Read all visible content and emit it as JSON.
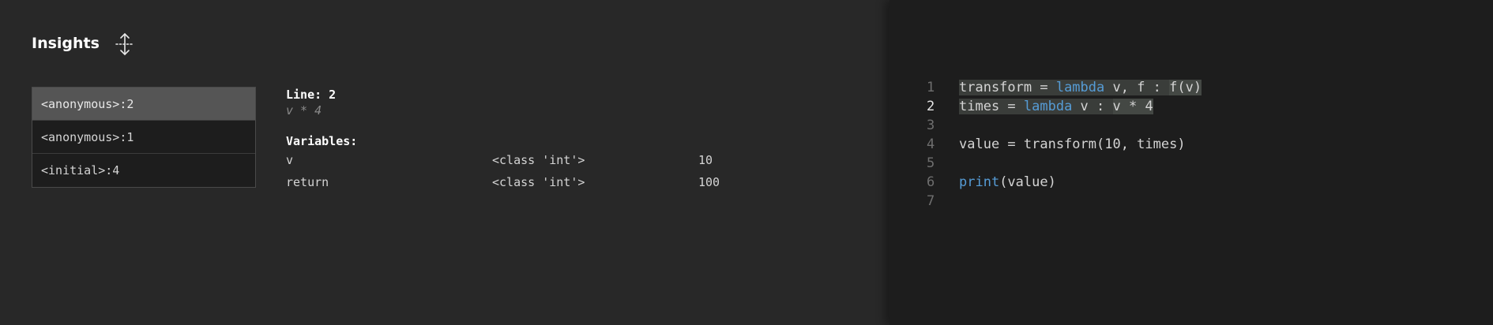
{
  "insights": {
    "title": "Insights",
    "stack": [
      {
        "label": "<anonymous>:2",
        "selected": true
      },
      {
        "label": "<anonymous>:1",
        "selected": false
      },
      {
        "label": "<initial>:4",
        "selected": false
      }
    ],
    "details": {
      "line_label": "Line: 2",
      "expression": "v * 4",
      "variables_label": "Variables:",
      "variables": [
        {
          "name": "v",
          "type": "<class 'int'>",
          "value": "10"
        },
        {
          "name": "return",
          "type": "<class 'int'>",
          "value": "100"
        }
      ]
    }
  },
  "editor": {
    "active_line": 2,
    "lines": [
      {
        "num": "1",
        "tokens": [
          {
            "t": "transform = ",
            "c": "hl"
          },
          {
            "t": "lambda",
            "c": "kw hl"
          },
          {
            "t": " v, f : ",
            "c": "hl"
          },
          {
            "t": "f(v)",
            "c": "hl2"
          }
        ]
      },
      {
        "num": "2",
        "tokens": [
          {
            "t": "times = ",
            "c": "hl"
          },
          {
            "t": "lambda",
            "c": "kw hl"
          },
          {
            "t": " v : ",
            "c": "hl"
          },
          {
            "t": "v * 4",
            "c": "hl2"
          }
        ]
      },
      {
        "num": "3",
        "tokens": []
      },
      {
        "num": "4",
        "tokens": [
          {
            "t": "value = transform(10, times)",
            "c": ""
          }
        ]
      },
      {
        "num": "5",
        "tokens": []
      },
      {
        "num": "6",
        "tokens": [
          {
            "t": "print",
            "c": "kw"
          },
          {
            "t": "(value)",
            "c": ""
          }
        ]
      },
      {
        "num": "7",
        "tokens": []
      }
    ]
  },
  "icons": {
    "drag_handle": "move-arrows-icon"
  },
  "colors": {
    "left_bg": "#282828",
    "right_bg": "#1d1d1d",
    "keyword": "#569cd6",
    "selected_item": "#555555"
  }
}
